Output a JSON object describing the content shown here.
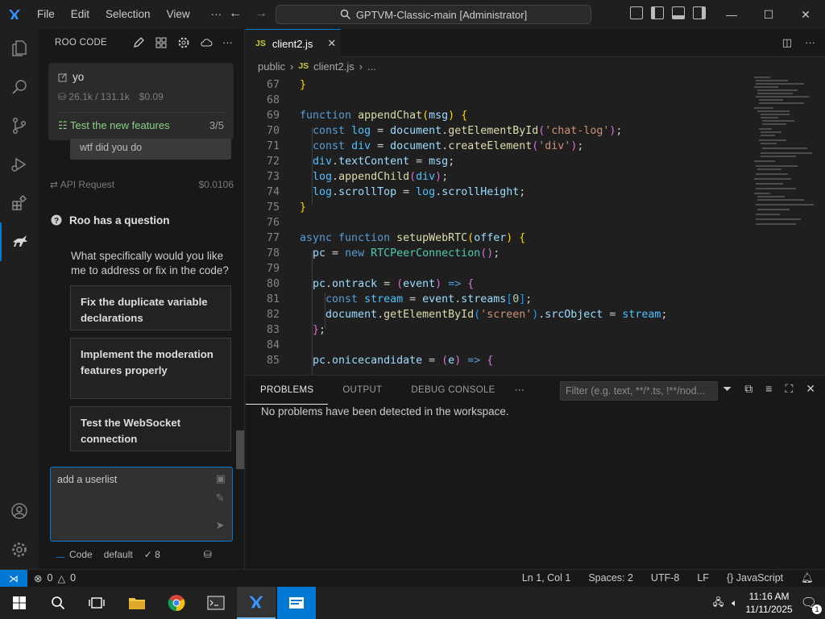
{
  "titlebar": {
    "menus": [
      "File",
      "Edit",
      "Selection",
      "View"
    ],
    "more": "···",
    "search_text": "GPTVM-Classic-main [Administrator]"
  },
  "sidebar": {
    "title": "ROO CODE",
    "task": {
      "title": "yo",
      "tokens": "26.1k / 131.1k",
      "cost": "$0.09",
      "todo": "Test the new features",
      "todo_count": "3/5"
    },
    "user_message": "wtf did you do",
    "api_request": {
      "label": "API Request",
      "cost": "$0.0106"
    },
    "question_header": "Roo has a question",
    "question_text": "What specifically would you like me to address or fix in the code?",
    "suggestions": [
      "Fix the duplicate variable declarations",
      "Implement the moderation features properly",
      "Test the WebSocket connection"
    ],
    "input_value": "add a userlist",
    "mode": "Code",
    "profile": "default",
    "auto_count": "8"
  },
  "editor": {
    "tab_label": "client2.js",
    "tab_badge": "JS",
    "breadcrumb": [
      "public",
      "client2.js",
      "..."
    ],
    "line_numbers": [
      "67",
      "68",
      "69",
      "70",
      "71",
      "72",
      "73",
      "74",
      "75",
      "76",
      "77",
      "78",
      "79",
      "80",
      "81",
      "82",
      "83",
      "84",
      "85"
    ]
  },
  "panel": {
    "tabs": [
      "PROBLEMS",
      "OUTPUT",
      "DEBUG CONSOLE"
    ],
    "more": "···",
    "filter_placeholder": "Filter (e.g. text, **/*.ts, !**/nod...",
    "message": "No problems have been detected in the workspace."
  },
  "statusbar": {
    "errors": "0",
    "warnings": "0",
    "cursor": "Ln 1, Col 1",
    "spaces": "Spaces: 2",
    "encoding": "UTF-8",
    "eol": "LF",
    "language": "JavaScript"
  },
  "taskbar": {
    "time": "11:16 AM",
    "date": "11/11/2025",
    "notifications": "1"
  },
  "colors": {
    "accent": "#0078d4",
    "todo_green": "#89d185"
  }
}
